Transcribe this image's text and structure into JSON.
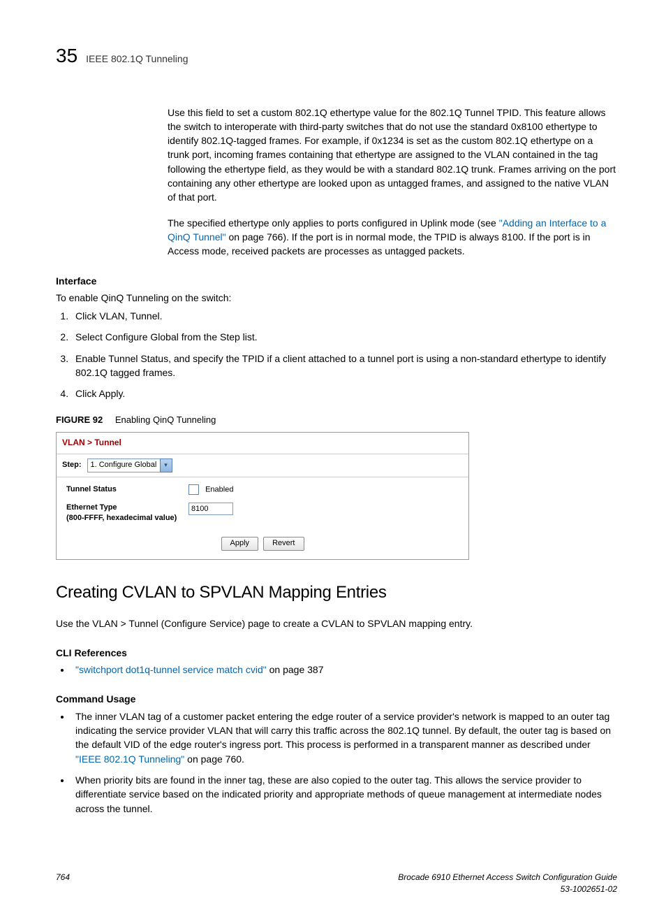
{
  "header": {
    "chapter_number": "35",
    "chapter_title": "IEEE 802.1Q Tunneling"
  },
  "body": {
    "para1": "Use this field to set a custom 802.1Q ethertype value for the 802.1Q Tunnel TPID. This feature allows the switch to interoperate with third-party switches that do not use the standard 0x8100 ethertype to identify 802.1Q-tagged frames. For example, if 0x1234 is set as the custom 802.1Q ethertype on a trunk port, incoming frames containing that ethertype are assigned to the VLAN contained in the tag following the ethertype field, as they would be with a standard 802.1Q trunk. Frames arriving on the port containing any other ethertype are looked upon as untagged frames, and assigned to the native VLAN of that port.",
    "para2a": "The specified ethertype only applies to ports configured in Uplink mode (see ",
    "para2_link": "\"Adding an Interface to a QinQ Tunnel\"",
    "para2b": " on page 766). If the port is in normal mode, the TPID is always 8100. If the port is in Access mode, received packets are processes as untagged packets.",
    "interface_heading": "Interface",
    "interface_intro": "To enable QinQ Tunneling on the switch:",
    "steps": [
      "Click VLAN, Tunnel.",
      "Select Configure Global from the Step list.",
      "Enable Tunnel Status, and specify the TPID if a client attached to a tunnel port is using a non-standard ethertype to identify 802.1Q tagged frames.",
      "Click Apply."
    ],
    "figure_label": "FIGURE 92",
    "figure_title": "Enabling QinQ Tunneling"
  },
  "figure": {
    "breadcrumb": "VLAN > Tunnel",
    "step_label": "Step:",
    "step_value": "1. Configure Global",
    "tunnel_status_label": "Tunnel Status",
    "enabled_label": "Enabled",
    "ethertype_label_line1": "Ethernet Type",
    "ethertype_label_line2": "(800-FFFF, hexadecimal value)",
    "ethertype_value": "8100",
    "apply_btn": "Apply",
    "revert_btn": "Revert"
  },
  "section2": {
    "title": "Creating CVLAN to SPVLAN Mapping Entries",
    "intro": "Use the VLAN > Tunnel (Configure Service) page to create a CVLAN to SPVLAN mapping entry.",
    "cli_heading": "CLI References",
    "cli_link": "\"switchport dot1q-tunnel service match cvid\"",
    "cli_suffix": " on page 387",
    "cmd_heading": "Command Usage",
    "bullet1a": "The inner VLAN tag of a customer packet entering the edge router of a service provider's network is mapped to an outer tag indicating the service provider VLAN that will carry this traffic across the 802.1Q tunnel. By default, the outer tag is based on the default VID of the edge router's ingress port. This process is performed in a transparent manner as described under ",
    "bullet1_link": "\"IEEE 802.1Q Tunneling\"",
    "bullet1b": " on page 760.",
    "bullet2": "When priority bits are found in the inner tag, these are also copied to the outer tag. This allows the service provider to differentiate service based on the indicated priority and appropriate methods of queue management at intermediate nodes across the tunnel."
  },
  "footer": {
    "page_number": "764",
    "doc_title": "Brocade 6910 Ethernet Access Switch Configuration Guide",
    "doc_id": "53-1002651-02"
  }
}
